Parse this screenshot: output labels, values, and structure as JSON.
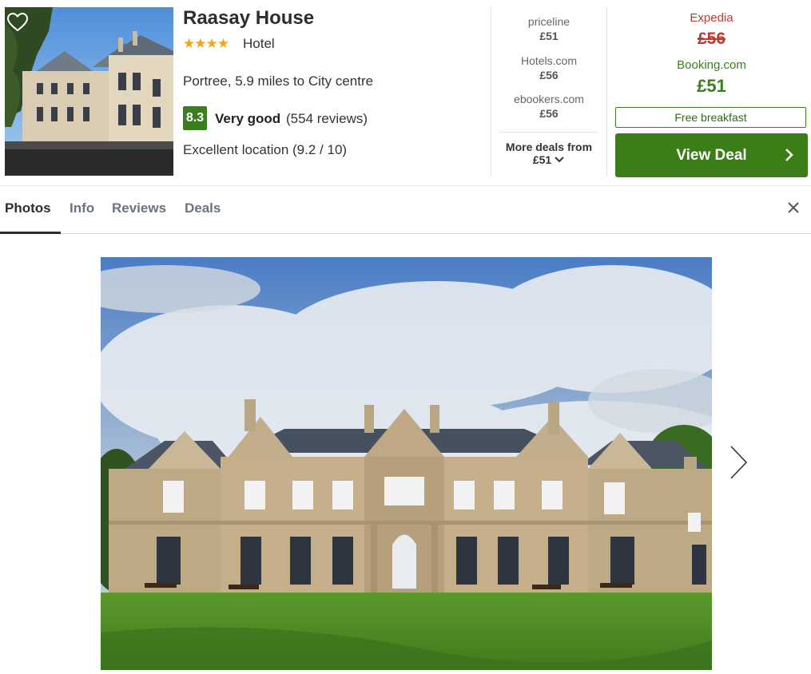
{
  "hotel": {
    "name": "Raasay House",
    "stars": "★★★★",
    "type": "Hotel",
    "location": "Portree, 5.9 miles to City centre",
    "score": "8.3",
    "rating_label": "Very good",
    "reviews": "(554 reviews)",
    "extra_rating": "Excellent location (9.2 / 10)"
  },
  "providers": [
    {
      "name": "priceline",
      "price": "£51"
    },
    {
      "name": "Hotels.com",
      "price": "£56"
    },
    {
      "name": "ebookers.com",
      "price": "£56"
    }
  ],
  "more_deals": {
    "label": "More deals from",
    "price": "£51"
  },
  "featured_deal": {
    "provider": "Expedia",
    "old_price": "£56",
    "best_provider": "Booking.com",
    "best_price": "£51",
    "perk": "Free breakfast",
    "button_label": "View Deal"
  },
  "tabs": [
    {
      "label": "Photos"
    },
    {
      "label": "Info"
    },
    {
      "label": "Reviews"
    },
    {
      "label": "Deals"
    }
  ],
  "icons": {
    "favorite": "heart-icon",
    "close": "close-icon",
    "next": "chevron-right-icon",
    "expand": "chevron-down-icon"
  },
  "colors": {
    "brand_green": "#3b7d16",
    "rating_green": "#3a7f1f",
    "strike_red": "#c0392b",
    "star_yellow": "#f2a51c"
  }
}
